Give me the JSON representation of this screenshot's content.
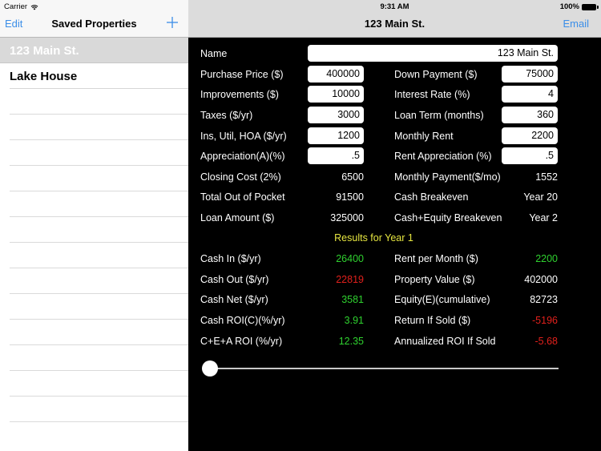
{
  "status_bar": {
    "carrier": "Carrier",
    "time": "9:31 AM",
    "battery": "100%"
  },
  "master": {
    "edit_label": "Edit",
    "title": "Saved Properties",
    "add_icon": "plus-icon",
    "items": [
      {
        "label": "123 Main St.",
        "selected": true
      },
      {
        "label": "Lake House",
        "selected": false
      }
    ]
  },
  "detail": {
    "title": "123 Main St.",
    "email_label": "Email",
    "name_label": "Name",
    "name_value": "123 Main St.",
    "inputs_left": [
      {
        "label": "Purchase Price ($)",
        "value": "400000"
      },
      {
        "label": "Improvements ($)",
        "value": "10000"
      },
      {
        "label": "Taxes ($/yr)",
        "value": "3000"
      },
      {
        "label": "Ins, Util, HOA ($/yr)",
        "value": "1200"
      },
      {
        "label": "Appreciation(A)(%)",
        "value": ".5"
      }
    ],
    "inputs_right": [
      {
        "label": "Down Payment ($)",
        "value": "75000"
      },
      {
        "label": "Interest Rate (%)",
        "value": "4"
      },
      {
        "label": "Loan Term (months)",
        "value": "360"
      },
      {
        "label": "Monthly Rent",
        "value": "2200"
      },
      {
        "label": "Rent Appreciation (%)",
        "value": ".5"
      }
    ],
    "computed_left": [
      {
        "label": "Closing Cost (2%)",
        "value": "6500"
      },
      {
        "label": "Total Out of Pocket",
        "value": "91500"
      },
      {
        "label": "Loan Amount ($)",
        "value": "325000"
      }
    ],
    "computed_right": [
      {
        "label": "Monthly Payment($/mo)",
        "value": "1552"
      },
      {
        "label": "Cash Breakeven",
        "value": "Year 20"
      },
      {
        "label": "Cash+Equity Breakeven",
        "value": "Year 2"
      }
    ],
    "results_title": "Results for Year 1",
    "results_left": [
      {
        "label": "Cash In ($/yr)",
        "value": "26400",
        "status": "positive"
      },
      {
        "label": "Cash Out ($/yr)",
        "value": "22819",
        "status": "negative"
      },
      {
        "label": "Cash Net ($/yr)",
        "value": "3581",
        "status": "positive"
      },
      {
        "label": "Cash ROI(C)(%/yr)",
        "value": "3.91",
        "status": "positive"
      },
      {
        "label": "C+E+A ROI (%/yr)",
        "value": "12.35",
        "status": "positive"
      }
    ],
    "results_right": [
      {
        "label": "Rent per Month ($)",
        "value": "2200",
        "status": "positive"
      },
      {
        "label": "Property Value ($)",
        "value": "402000",
        "status": "neutral"
      },
      {
        "label": "Equity(E)(cumulative)",
        "value": "82723",
        "status": "neutral"
      },
      {
        "label": "Return If Sold ($)",
        "value": "-5196",
        "status": "negative"
      },
      {
        "label": "Annualized ROI If Sold",
        "value": "-5.68",
        "status": "negative"
      }
    ],
    "year_slider": {
      "value_fraction": 0.0
    }
  },
  "colors": {
    "accent": "#3b8ee8",
    "positive": "#2fd12f",
    "negative": "#e0201c",
    "results_title": "#e6e640",
    "background": "#000000"
  }
}
